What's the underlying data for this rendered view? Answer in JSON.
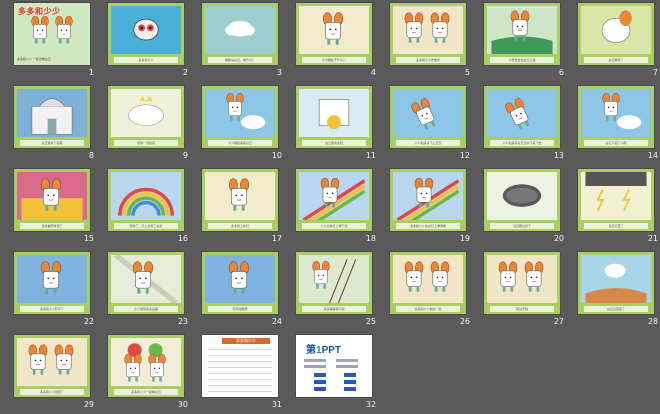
{
  "window": {
    "title": "多多和少少"
  },
  "slides": [
    {
      "n": "1",
      "caption": "",
      "kind": "title"
    },
    {
      "n": "2",
      "caption": "多多和少少",
      "kind": "face"
    },
    {
      "n": "3",
      "caption": "看那朵白云，像什么？",
      "kind": "cloud"
    },
    {
      "n": "4",
      "caption": "小方糖在干什么？",
      "kind": "mouse"
    },
    {
      "n": "5",
      "caption": "多多和少少去散步",
      "kind": "mouse2"
    },
    {
      "n": "6",
      "caption": "小老鼠坐在白云上面",
      "kind": "mouse-green"
    },
    {
      "n": "7",
      "caption": "白云飘走了",
      "kind": "cloud-fly"
    },
    {
      "n": "8",
      "caption": "白云变成了宫殿",
      "kind": "palace"
    },
    {
      "n": "9",
      "caption": "变成一顶皇冠",
      "kind": "crown"
    },
    {
      "n": "10",
      "caption": "少少跳起来抓白云",
      "kind": "mouse-sky"
    },
    {
      "n": "11",
      "caption": "白云变成太阳",
      "kind": "sun"
    },
    {
      "n": "12",
      "caption": "少少和多多飞上天空",
      "kind": "mouse-fly"
    },
    {
      "n": "13",
      "caption": "少少和多多在天空中飞来飞去",
      "kind": "mouse-fly"
    },
    {
      "n": "14",
      "caption": "白云下起了小雨",
      "kind": "mouse-sky"
    },
    {
      "n": "15",
      "caption": "多多被雨淋湿了",
      "kind": "orange"
    },
    {
      "n": "16",
      "caption": "雨停了，天上出现了彩虹",
      "kind": "rainbow"
    },
    {
      "n": "17",
      "caption": "多多爬上彩虹",
      "kind": "mouse"
    },
    {
      "n": "18",
      "caption": "少少从彩虹上滑下来",
      "kind": "rainbow-mouse"
    },
    {
      "n": "19",
      "caption": "多多和少少在彩虹上滑滑梯",
      "kind": "rainbow-mouse"
    },
    {
      "n": "20",
      "caption": "乌云飘过来了",
      "kind": "dark-cloud"
    },
    {
      "n": "21",
      "caption": "乌云打雷了",
      "kind": "storm"
    },
    {
      "n": "22",
      "caption": "多多和少少吓坏了",
      "kind": "mouse-blue"
    },
    {
      "n": "23",
      "caption": "少少躲到多多后面",
      "kind": "mouse-stripe"
    },
    {
      "n": "24",
      "caption": "雷声轰隆隆",
      "kind": "mouse-blue"
    },
    {
      "n": "25",
      "caption": "多多撑着梯子爬",
      "kind": "ladder"
    },
    {
      "n": "26",
      "caption": "多多和少少抱在一起",
      "kind": "mouse2"
    },
    {
      "n": "27",
      "caption": "雨过天晴",
      "kind": "mouse2"
    },
    {
      "n": "28",
      "caption": "白云又回来了",
      "kind": "cloud-hill"
    },
    {
      "n": "29",
      "caption": "多多和少少回家了",
      "kind": "mouse2"
    },
    {
      "n": "30",
      "caption": "多多和少少一起看白云",
      "kind": "flowers"
    },
    {
      "n": "31",
      "caption": "",
      "kind": "sheet"
    },
    {
      "n": "32",
      "caption": "",
      "kind": "ppt"
    }
  ],
  "cover": {
    "title": "多多和少少",
    "subtitle": "多多和少少 一起去看白云"
  },
  "sheet": {
    "banner": "多多和少少"
  },
  "ppt": {
    "brand_a": "第",
    "brand_b": "1",
    "brand_c": "PPT"
  },
  "colors": {
    "frame": "#a8cf63",
    "background": "#5a5a5a",
    "caption_bg": "#eaf3da"
  }
}
